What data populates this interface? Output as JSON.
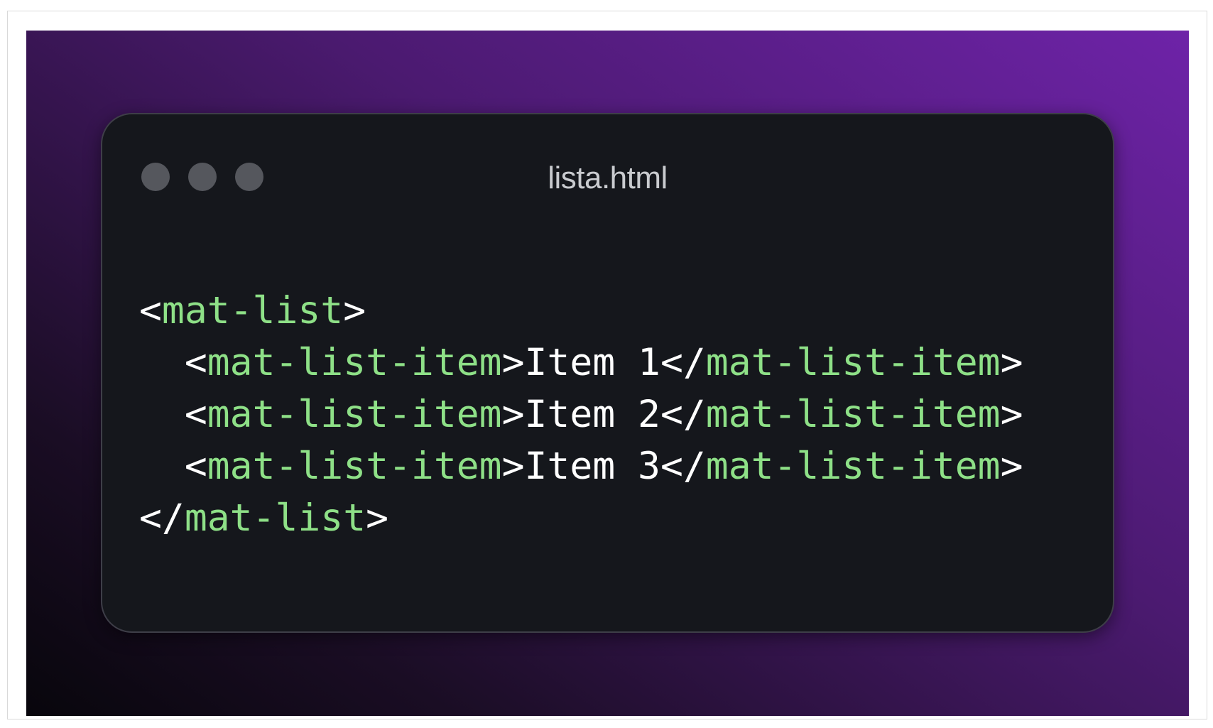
{
  "window": {
    "title": "lista.html",
    "accent_colors": {
      "tag": "#8ee087",
      "text": "#ffffff",
      "background": "#15171c",
      "dots": "#55575d"
    }
  },
  "code": {
    "lines": [
      {
        "indent": "",
        "open": "<",
        "tag1": "mat-list",
        "close": ">",
        "content": "",
        "open2": "",
        "tag2": "",
        "close2": ""
      },
      {
        "indent": "  ",
        "open": "<",
        "tag1": "mat-list-item",
        "close": ">",
        "content": "Item 1",
        "open2": "</",
        "tag2": "mat-list-item",
        "close2": ">"
      },
      {
        "indent": "  ",
        "open": "<",
        "tag1": "mat-list-item",
        "close": ">",
        "content": "Item 2",
        "open2": "</",
        "tag2": "mat-list-item",
        "close2": ">"
      },
      {
        "indent": "  ",
        "open": "<",
        "tag1": "mat-list-item",
        "close": ">",
        "content": "Item 3",
        "open2": "</",
        "tag2": "mat-list-item",
        "close2": ">"
      },
      {
        "indent": "",
        "open": "</",
        "tag1": "mat-list",
        "close": ">",
        "content": "",
        "open2": "",
        "tag2": "",
        "close2": ""
      }
    ]
  }
}
